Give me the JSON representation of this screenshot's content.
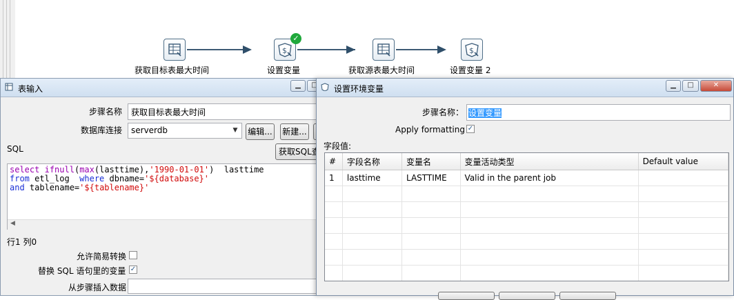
{
  "canvas": {
    "steps": [
      {
        "label": "获取目标表最大时间",
        "icon": "table-input-icon"
      },
      {
        "label": "设置变量",
        "icon": "set-variable-icon"
      },
      {
        "label": "获取源表最大时间",
        "icon": "table-input-icon"
      },
      {
        "label": "设置变量 2",
        "icon": "set-variable-icon"
      }
    ],
    "check_mark": "✓"
  },
  "table_input_dialog": {
    "title": "表输入",
    "step_name_label": "步骤名称",
    "step_name_value": "获取目标表最大时间",
    "db_conn_label": "数据库连接",
    "db_conn_value": "serverdb",
    "edit_button": "编辑...",
    "new_button": "新建...",
    "sql_label": "SQL",
    "get_sql_button": "获取SQL查",
    "sql_lines": {
      "l1_kw1": "select",
      "l1_fn": "ifnull",
      "l1_p1": "(",
      "l1_fn2": "max",
      "l1_p2": "(lasttime),",
      "l1_str": "'1990-01-01'",
      "l1_rest": ")  lasttime",
      "l2_kw": "from",
      "l2_mid": " etl_log  ",
      "l2_kw2": "where",
      "l2_mid2": " dbname=",
      "l2_str": "'${database}'",
      "l3_kw": "and",
      "l3_mid": " tablename=",
      "l3_str": "'${tablename}'"
    },
    "position_text": "行1 列0",
    "lazy_conversion_label": "允许简易转换",
    "replace_vars_label": "替换 SQL 语句里的变量",
    "replace_vars_checked": "✓",
    "insert_from_step_label": "从步骤插入数据"
  },
  "set_var_dialog": {
    "title": "设置环境变量",
    "step_name_label": "步骤名称：",
    "step_name_value": "设置变量",
    "apply_formatting_label": "Apply formatting",
    "apply_formatting_checked": "✓",
    "fields_label": "字段值:",
    "columns": [
      "#",
      "字段名称",
      "变量名",
      "变量活动类型",
      "Default value"
    ],
    "rows": [
      {
        "num": "1",
        "field": "lasttime",
        "var": "LASTTIME",
        "type": "Valid in the parent job",
        "default": ""
      }
    ]
  }
}
